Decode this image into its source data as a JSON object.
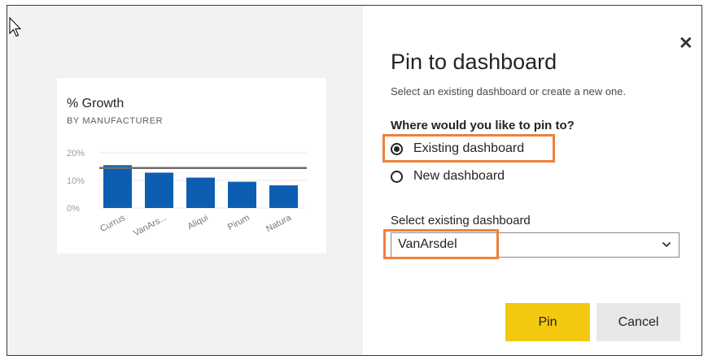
{
  "chart": {
    "title": "% Growth",
    "subtitle": "BY MANUFACTURER"
  },
  "chart_data": {
    "type": "bar",
    "title": "% Growth",
    "subtitle": "BY MANUFACTURER",
    "categories": [
      "Currus",
      "VanArs...",
      "Aliqui",
      "Pirum",
      "Natura"
    ],
    "values": [
      15.5,
      12.8,
      11.0,
      9.5,
      8.2
    ],
    "y_ticks": [
      "20%",
      "10%",
      "0%"
    ],
    "ylim": [
      0,
      20
    ],
    "reference_line": 14.5,
    "grid": true,
    "colors": {
      "bar": "#0d5eb3",
      "reference_line": "#6e6e6e",
      "grid": "#e8e8e8"
    }
  },
  "dialog": {
    "title": "Pin to dashboard",
    "description": "Select an existing dashboard or create a new one.",
    "question": "Where would you like to pin to?",
    "options": [
      {
        "label": "Existing dashboard",
        "selected": true
      },
      {
        "label": "New dashboard",
        "selected": false
      }
    ],
    "select_label": "Select existing dashboard",
    "select_value": "VanArsdel",
    "pin_label": "Pin",
    "cancel_label": "Cancel",
    "close_icon": "close-icon"
  },
  "colors": {
    "highlight": "#f0803c",
    "pin_button": "#f2c811",
    "cancel_button": "#e8e8e8",
    "left_panel": "#f3f2f1"
  }
}
